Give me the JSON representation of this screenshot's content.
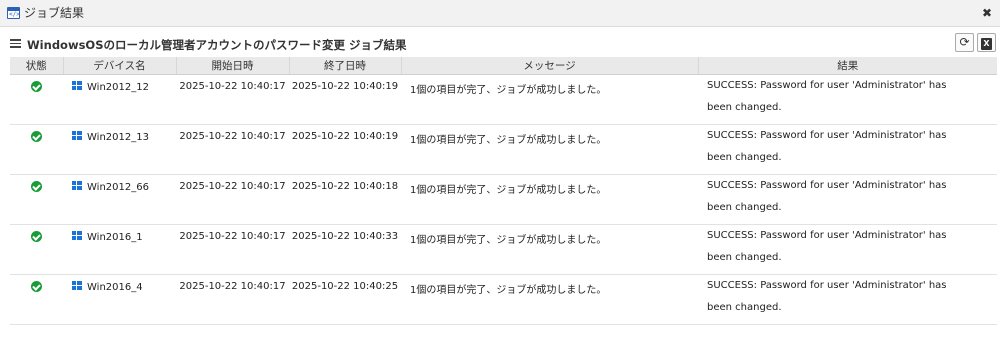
{
  "window": {
    "title": "ジョブ結果",
    "close_label": "✖"
  },
  "panel": {
    "heading": "WindowsOSのローカル管理者アカウントのパスワード変更 ジョブ結果",
    "refresh_icon": "refresh-icon",
    "excel_icon": "excel-export-icon"
  },
  "table": {
    "columns": [
      "状態",
      "デバイス名",
      "開始日時",
      "終了日時",
      "メッセージ",
      "結果"
    ],
    "rows": [
      {
        "status": "success",
        "device": "Win2012_12",
        "start": "2025-10-22 10:40:17",
        "end": "2025-10-22 10:40:19",
        "message": "1個の項目が完了、ジョブが成功しました。",
        "result": "SUCCESS: Password for user 'Administrator' has been changed."
      },
      {
        "status": "success",
        "device": "Win2012_13",
        "start": "2025-10-22 10:40:17",
        "end": "2025-10-22 10:40:19",
        "message": "1個の項目が完了、ジョブが成功しました。",
        "result": "SUCCESS: Password for user 'Administrator' has been changed."
      },
      {
        "status": "success",
        "device": "Win2012_66",
        "start": "2025-10-22 10:40:17",
        "end": "2025-10-22 10:40:18",
        "message": "1個の項目が完了、ジョブが成功しました。",
        "result": "SUCCESS: Password for user 'Administrator' has been changed."
      },
      {
        "status": "success",
        "device": "Win2016_1",
        "start": "2025-10-22 10:40:17",
        "end": "2025-10-22 10:40:33",
        "message": "1個の項目が完了、ジョブが成功しました。",
        "result": "SUCCESS: Password for user 'Administrator' has been changed."
      },
      {
        "status": "success",
        "device": "Win2016_4",
        "start": "2025-10-22 10:40:17",
        "end": "2025-10-22 10:40:25",
        "message": "1個の項目が完了、ジョブが成功しました。",
        "result": "SUCCESS: Password for user 'Administrator' has been changed."
      }
    ]
  },
  "colors": {
    "success": "#1a9b3a",
    "windows": "#1a73d9",
    "header_bg": "#e9e9e9"
  }
}
